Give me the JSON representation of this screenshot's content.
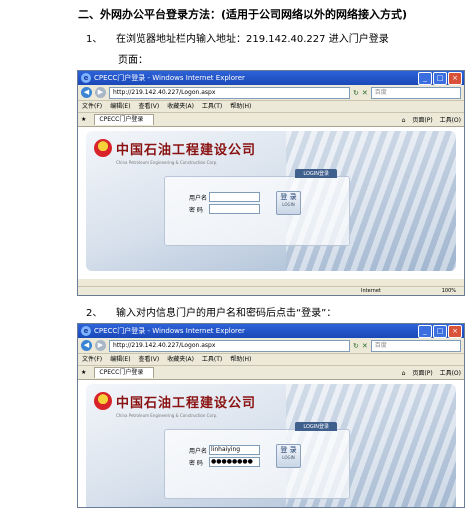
{
  "heading": "二、外网办公平台登录方法：(适用于公司网络以外的网络接入方式)",
  "steps": [
    {
      "number": "1、",
      "text": "在浏览器地址栏内输入地址：219.142.40.227 进入门户登录",
      "text_cont": "页面："
    },
    {
      "number": "2、",
      "text": "输入对内信息门户的用户名和密码后点击“登录”："
    }
  ],
  "browser": {
    "window_title": "CPECC门户登录 - Windows Internet Explorer",
    "url": "http://219.142.40.227/Logon.aspx",
    "search_placeholder": "百度",
    "menus": [
      "文件(F)",
      "编辑(E)",
      "查看(V)",
      "收藏夹(A)",
      "工具(T)",
      "帮助(H)"
    ],
    "tab_label": "CPECC门户登录",
    "tools": [
      "页面(P)",
      "工具(O)"
    ],
    "status_zone": "Internet",
    "zoom": "100%"
  },
  "portal": {
    "company_name": "中国石油工程建设公司",
    "company_name_en": "China Petroleum Engineering & Construction Corp.",
    "login_tab": "LOGIN登录",
    "username_label": "用户名",
    "password_label": "密  码",
    "login_button": "登 录",
    "login_button_en": "LOGIN"
  },
  "screenshot2": {
    "username_value": "linhaiying",
    "password_value": "●●●●●●●●"
  },
  "colors": {
    "titlebar": "#2d63d8",
    "company_red": "#8a1212"
  }
}
